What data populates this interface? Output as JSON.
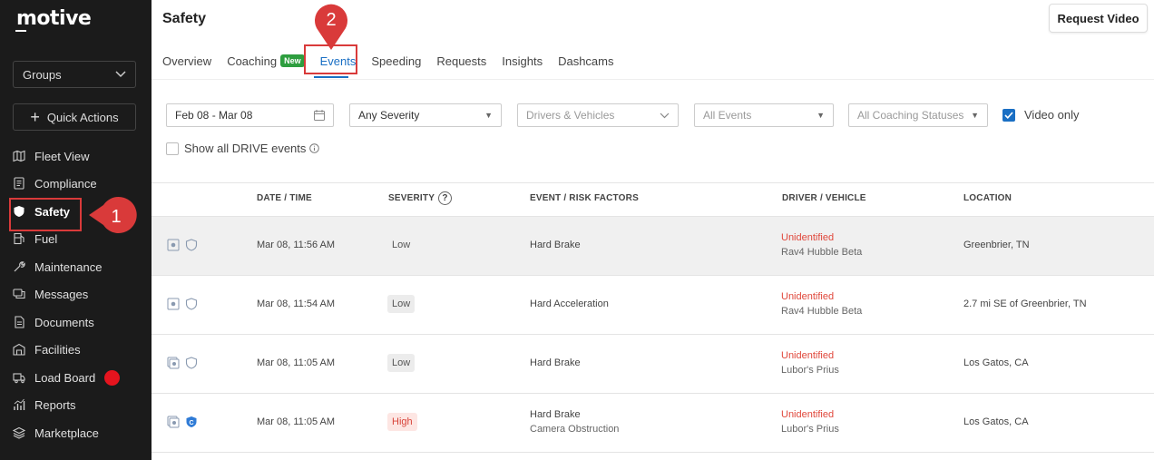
{
  "app": {
    "logo": "motive"
  },
  "sidebar": {
    "groups_label": "Groups",
    "quick_actions_label": "Quick Actions",
    "items": [
      {
        "label": "Fleet View",
        "icon": "map-icon"
      },
      {
        "label": "Compliance",
        "icon": "document-icon"
      },
      {
        "label": "Safety",
        "icon": "shield-icon"
      },
      {
        "label": "Fuel",
        "icon": "fuel-pump-icon"
      },
      {
        "label": "Maintenance",
        "icon": "wrench-icon"
      },
      {
        "label": "Messages",
        "icon": "chat-icon"
      },
      {
        "label": "Documents",
        "icon": "file-icon"
      },
      {
        "label": "Facilities",
        "icon": "building-icon"
      },
      {
        "label": "Load Board",
        "icon": "truck-icon"
      },
      {
        "label": "Reports",
        "icon": "chart-icon"
      },
      {
        "label": "Marketplace",
        "icon": "layers-icon"
      }
    ]
  },
  "markers": {
    "one": "1",
    "two": "2"
  },
  "header": {
    "title": "Safety",
    "request_video_label": "Request Video"
  },
  "tabs": [
    {
      "label": "Overview"
    },
    {
      "label": "Coaching",
      "badge": "New"
    },
    {
      "label": "Events"
    },
    {
      "label": "Speeding"
    },
    {
      "label": "Requests"
    },
    {
      "label": "Insights"
    },
    {
      "label": "Dashcams"
    }
  ],
  "filters": {
    "date_range": "Feb 08 - Mar 08",
    "severity": "Any Severity",
    "drivers": "Drivers & Vehicles",
    "events": "All Events",
    "coaching": "All Coaching Statuses",
    "video_only_label": "Video only",
    "show_all_label": "Show all DRIVE events"
  },
  "table": {
    "headers": {
      "datetime": "DATE / TIME",
      "severity": "SEVERITY",
      "event": "EVENT / RISK FACTORS",
      "driver": "DRIVER / VEHICLE",
      "location": "LOCATION"
    },
    "rows": [
      {
        "datetime": "Mar 08, 11:56 AM",
        "severity": "Low",
        "event": "Hard Brake",
        "risk": "",
        "driver": "Unidentified",
        "vehicle": "Rav4 Hubble Beta",
        "location": "Greenbrier, TN"
      },
      {
        "datetime": "Mar 08, 11:54 AM",
        "severity": "Low",
        "event": "Hard Acceleration",
        "risk": "",
        "driver": "Unidentified",
        "vehicle": "Rav4 Hubble Beta",
        "location": "2.7 mi SE of Greenbrier, TN"
      },
      {
        "datetime": "Mar 08, 11:05 AM",
        "severity": "Low",
        "event": "Hard Brake",
        "risk": "",
        "driver": "Unidentified",
        "vehicle": "Lubor's Prius",
        "location": "Los Gatos, CA"
      },
      {
        "datetime": "Mar 08, 11:05 AM",
        "severity": "High",
        "event": "Hard Brake",
        "risk": "Camera Obstruction",
        "driver": "Unidentified",
        "vehicle": "Lubor's Prius",
        "location": "Los Gatos, CA"
      }
    ]
  },
  "colors": {
    "accent": "#1a6fc4",
    "highlight": "#d93a3a",
    "driver_red": "#e0473b",
    "new_badge": "#2e9e3f"
  }
}
